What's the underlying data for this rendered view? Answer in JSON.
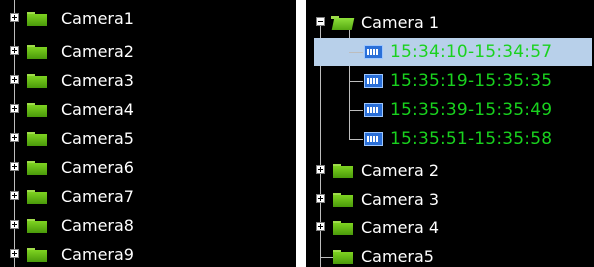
{
  "left_tree": {
    "items": [
      {
        "label": "Camera1"
      },
      {
        "label": "Camera2"
      },
      {
        "label": "Camera3"
      },
      {
        "label": "Camera4"
      },
      {
        "label": "Camera5"
      },
      {
        "label": "Camera6"
      },
      {
        "label": "Camera7"
      },
      {
        "label": "Camera8"
      },
      {
        "label": "Camera9"
      }
    ]
  },
  "right_tree": {
    "expanded": {
      "label": "Camera 1",
      "recordings": [
        {
          "label": "15:34:10-15:34:57",
          "selected": true
        },
        {
          "label": "15:35:19-15:35:35",
          "selected": false
        },
        {
          "label": "15:35:39-15:35:49",
          "selected": false
        },
        {
          "label": "15:35:51-15:35:58",
          "selected": false
        }
      ]
    },
    "collapsed": [
      {
        "label": "Camera 2"
      },
      {
        "label": "Camera 3"
      },
      {
        "label": "Camera 4"
      },
      {
        "label": "Camera5"
      }
    ]
  },
  "colors": {
    "background": "#000000",
    "text": "#ffffff",
    "recording_text": "#19d21e",
    "selection": "#b8d0ea",
    "folder": "#7ed321",
    "recording_icon": "#2a6fd8"
  },
  "icons": [
    "plus-expander-icon",
    "minus-expander-icon",
    "folder-icon",
    "open-folder-icon",
    "recording-icon"
  ]
}
